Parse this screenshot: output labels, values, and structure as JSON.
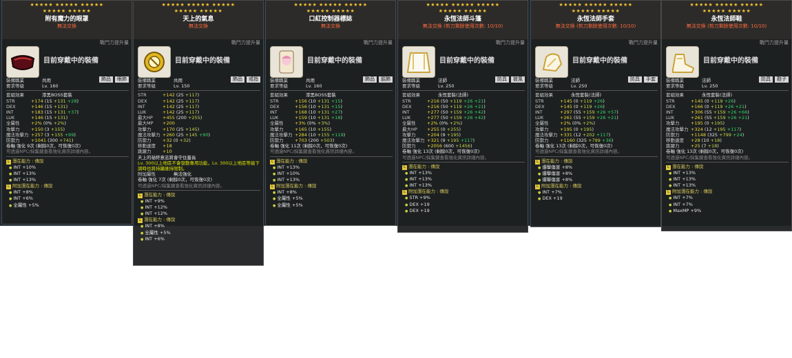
{
  "panels": [
    {
      "name": "附有魔力的眼罩",
      "trade": "無法交換",
      "combat_label": "戰鬥力提升量",
      "equip_text": "目前穿戴中的裝備",
      "tags": [
        "飾品",
        "眼飾"
      ],
      "icon": "eyepatch-icon",
      "job_label": "裝備職業",
      "job": "共用",
      "level_label": "要求等級",
      "level": "Lv. 160",
      "set_label": "套組效果",
      "set": "漆黑BOSS套裝",
      "stats": [
        [
          "STR",
          "+174",
          "(15 +131 +28)"
        ],
        [
          "DEX",
          "+146",
          "(15 +131)"
        ],
        [
          "INT",
          "+183",
          "(15 +131 +37)"
        ],
        [
          "LUK",
          "+146",
          "(15 +131)"
        ],
        [
          "全屬性",
          "+2%",
          "(0% +2%)"
        ],
        [
          "攻擊力",
          "+150",
          "(3 +155)"
        ],
        [
          "魔法攻擊力",
          "+257",
          "(3 +155 +99)"
        ],
        [
          "防禦力",
          "+1041",
          "(300 +741)"
        ]
      ],
      "upgrade": "卷軸 強化 9次 (剩餘0次，可恢復0次)",
      "hint": "可透過NPC/採集鍵查看強化資訊詳細內容。",
      "pot_header": "潛在能力 : 傳說",
      "pots": [
        "INT +10%",
        "INT +13%",
        "INT +13%"
      ],
      "add_pot_header": "附加潛在能力 : 傳說",
      "add_pots": [
        "INT +8%",
        "INT +6%",
        "全屬性 +5%"
      ]
    },
    {
      "name": "天上的氣息",
      "trade": "無法交換",
      "combat_label": "戰鬥力提升量",
      "equip_text": "目前穿戴中的裝備",
      "tags": [
        "飾品",
        "戒指"
      ],
      "icon": "ring-icon",
      "job_label": "裝備職業",
      "job": "共用",
      "level_label": "要求等級",
      "level": "Lv. 150",
      "stats": [
        [
          "STR",
          "+142",
          "(25 +117)"
        ],
        [
          "DEX",
          "+142",
          "(25 +117)"
        ],
        [
          "INT",
          "+142",
          "(25 +117)"
        ],
        [
          "LUK",
          "+142",
          "(25 +117)"
        ],
        [
          "最大HP",
          "+455",
          "(200 +255)"
        ],
        [
          "最大MP",
          "+200",
          ""
        ],
        [
          "攻擊力",
          "+170",
          "(25 +145)"
        ],
        [
          "魔法攻擊力",
          "+260",
          "(25 +145 +90)"
        ],
        [
          "防禦力",
          "+32",
          "(0 +32)"
        ],
        [
          "移動速度",
          "+18",
          ""
        ],
        [
          "跳躍力",
          "+10",
          ""
        ]
      ],
      "desc": "天上的祕終意志將會守住蓋長",
      "note": "Lv. 300以上地區不會發動專用功能，Lv. 300以上地區等級下調時也將持續維持限制。",
      "extra_label": "附加屬性",
      "extra": "無法強化",
      "upgrade": "卷軸 強化 7次 (剩餘0次，可恢復0次)",
      "hint": "可透過NPC/採集鍵查看強化資訊詳細內容。",
      "pot_header": "潛在能力 : 傳說",
      "pots": [
        "INT +9%",
        "INT +12%",
        "INT +12%"
      ],
      "add_pot_header": "潛在能力 : 傳說",
      "add_pots": [
        "INT +8%",
        "全屬性 +5%",
        "INT +6%"
      ]
    },
    {
      "name": "口紅控制器標誌",
      "trade": "無法交換",
      "combat_label": "戰鬥力提升量",
      "equip_text": "目前穿戴中的裝備",
      "tags": [
        "飾品",
        "臉飾"
      ],
      "icon": "emblem-icon",
      "job_label": "裝備職業",
      "job": "共用",
      "level_label": "要求等級",
      "level": "Lv. 160",
      "set_label": "套組效果",
      "set": "漆黑BOSS套裝",
      "stats": [
        [
          "STR",
          "+156",
          "(10 +131 +15)"
        ],
        [
          "DEX",
          "+156",
          "(10 +131 +15)"
        ],
        [
          "INT",
          "+168",
          "(10 +131 +27)"
        ],
        [
          "LUK",
          "+159",
          "(10 +131 +18)"
        ],
        [
          "全屬性",
          "+3%",
          "(0% +3%)"
        ],
        [
          "攻擊力",
          "+165",
          "(10 +155)"
        ],
        [
          "魔法攻擊力",
          "+284",
          "(10 +155 +119)"
        ],
        [
          "防禦力",
          "+703",
          "(200 +503)"
        ]
      ],
      "upgrade": "卷軸 強化 11次 (剩餘0次，可恢復0次)",
      "hint": "可透過NPC/採集鍵查看強化資訊詳細內容。",
      "pot_header": "潛在能力 : 傳說",
      "pots": [
        "INT +13%",
        "INT +10%",
        "INT +13%"
      ],
      "add_pot_header": "附加潛在能力 : 傳說",
      "add_pots": [
        "INT +8%",
        "全屬性 +5%",
        "全屬性 +5%"
      ]
    },
    {
      "name": "永恆法師斗篷",
      "trade": "無法交換 (剪刀剩餘使用次數: 10/10)",
      "combat_label": "戰鬥力提升量",
      "equip_text": "目前穿戴中的裝備",
      "tags": [
        "防具",
        "披風"
      ],
      "icon": "cape-icon",
      "job_label": "裝備職業",
      "job": "法師",
      "level_label": "要求等級",
      "level": "Lv. 250",
      "set_label": "套組效果",
      "set": "永恆套裝(法師)",
      "stats": [
        [
          "STR",
          "+216",
          "(50 +119 +26 +21)"
        ],
        [
          "DEX",
          "+216",
          "(50 +119 +26 +21)"
        ],
        [
          "INT",
          "+277",
          "(50 +159 +26 +42)"
        ],
        [
          "LUK",
          "+277",
          "(50 +159 +26 +42)"
        ],
        [
          "全屬性",
          "+2%",
          "(0% +2%)"
        ],
        [
          "最大HP",
          "+255",
          "(0 +255)"
        ],
        [
          "攻擊力",
          "+204",
          "(9 +195)"
        ],
        [
          "魔法攻擊力",
          "+321",
          "(9 +195 +117)"
        ],
        [
          "防禦力",
          "+2056",
          "(600 +1456)"
        ]
      ],
      "upgrade": "卷軸 強化 13次 (剩餘0次，可恢復0次)",
      "hint": "可透過NPC/採集鍵查看強化資訊詳細內容。",
      "pot_header": "潛在能力 : 傳說",
      "pots": [
        "INT +13%",
        "INT +13%",
        "INT +13%"
      ],
      "add_pot_header": "附加潛在能力 : 傳說",
      "add_pots": [
        "STR +9%",
        "DEX +19",
        "DEX +19"
      ]
    },
    {
      "name": "永恆法師手套",
      "trade": "無法交換 (剪刀剩餘使用次數: 10/10)",
      "combat_label": "戰鬥力提升量",
      "equip_text": "目前穿戴中的裝備",
      "tags": [
        "防具",
        "手套"
      ],
      "icon": "glove-icon",
      "job_label": "裝備職業",
      "job": "法師",
      "level_label": "要求等級",
      "level": "Lv. 250",
      "set_label": "套組效果",
      "set": "永恆套裝(法師)",
      "stats": [
        [
          "STR",
          "+145",
          "(0 +119 +26)"
        ],
        [
          "DEX",
          "+145",
          "(0 +119 +26)"
        ],
        [
          "INT",
          "+297",
          "(55 +159 +26 +57)"
        ],
        [
          "LUK",
          "+261",
          "(55 +159 +26 +21)"
        ],
        [
          "全屬性",
          "+2%",
          "(0% +2%)"
        ],
        [
          "攻擊力",
          "+195",
          "(0 +195)"
        ],
        [
          "魔法攻擊力",
          "+331",
          "(12 +202 +117)"
        ],
        [
          "防禦力",
          "+1160",
          "(325 +799 +36)"
        ]
      ],
      "upgrade": "卷軸 強化 13次 (剩餘0次，可恢復0次)",
      "hint": "可透過NPC/採集鍵查看強化資訊詳細內容。",
      "pot_header": "潛在能力 : 傳說",
      "pots": [
        "爆擊傷害 +8%",
        "爆擊傷害 +8%",
        "爆擊傷害 +8%"
      ],
      "add_pot_header": "附加潛在能力 : 傳說",
      "add_pots": [
        "INT +7%",
        "DEX +19"
      ]
    },
    {
      "name": "永恆法師鞋",
      "trade": "無法交換 (剪刀剩餘使用次數: 10/10)",
      "combat_label": "戰鬥力提升量",
      "equip_text": "目前穿戴中的裝備",
      "tags": [
        "防具",
        "鞋子"
      ],
      "icon": "shoe-icon",
      "job_label": "裝備職業",
      "job": "法師",
      "level_label": "要求等級",
      "level": "Lv. 250",
      "set_label": "套組效果",
      "set": "永恆套裝(法師)",
      "stats": [
        [
          "STR",
          "+145",
          "(0 +119 +26)"
        ],
        [
          "DEX",
          "+166",
          "(0 +119 +26 +21)"
        ],
        [
          "INT",
          "+306",
          "(55 +159 +26 +66)"
        ],
        [
          "LUK",
          "+261",
          "(55 +159 +26 +21)"
        ],
        [
          "攻擊力",
          "+195",
          "(0 +195)"
        ],
        [
          "魔法攻擊力",
          "+324",
          "(12 +195 +117)"
        ],
        [
          "防禦力",
          "+1148",
          "(325 +799 +24)"
        ],
        [
          "移動速度",
          "+28",
          "(10 +18)"
        ],
        [
          "跳躍力",
          "+25",
          "(7 +18)"
        ]
      ],
      "upgrade": "卷軸 強化 13次 (剩餘0次，可恢復0次)",
      "hint": "可透過NPC/採集鍵查看強化資訊詳細內容。",
      "pot_header": "潛在能力 : 傳說",
      "pots": [
        "INT +13%",
        "INT +13%",
        "INT +13%"
      ],
      "add_pot_header": "附加潛在能力 : 傳說",
      "add_pots": [
        "INT +7%",
        "INT +7%",
        "MaxMP +9%"
      ]
    }
  ]
}
